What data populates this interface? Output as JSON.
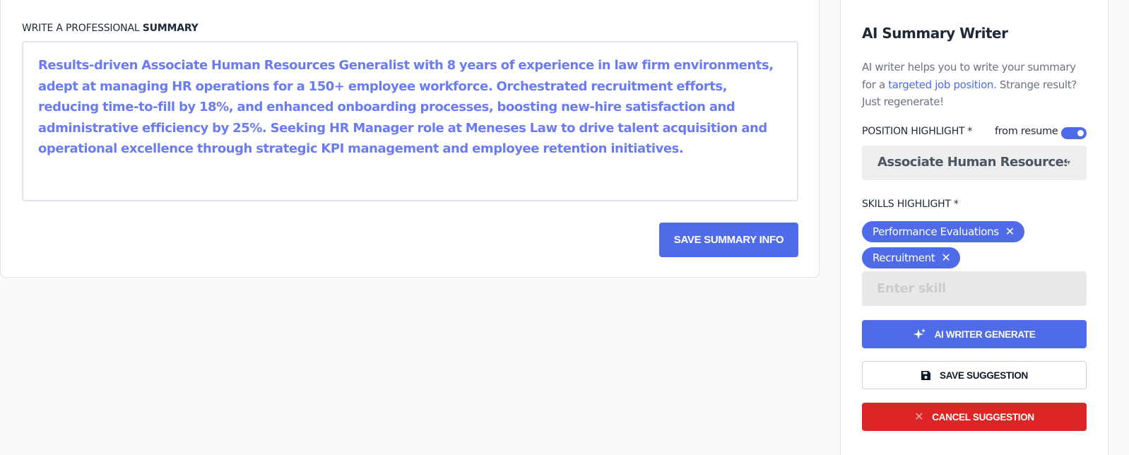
{
  "summary": {
    "heading_prefix": "WRITE A PROFESSIONAL ",
    "heading_bold": "SUMMARY",
    "text": "Results-driven Associate Human Resources Generalist with 8 years of experience in law firm environments, adept at managing HR operations for a 150+ employee workforce. Orchestrated recruitment efforts, reducing time-to-fill by 18%, and enhanced onboarding processes, boosting new-hire satisfaction and administrative efficiency by 25%. Seeking HR Manager role at Meneses Law to drive talent acquisition and operational excellence through strategic KPI management and employee retention initiatives.",
    "save_label": "SAVE SUMMARY INFO"
  },
  "ai_panel": {
    "title": "AI Summary Writer",
    "description_start": "AI writer helps you to write your summary for a ",
    "description_link": "targeted job position",
    "description_end": ". Strange result? Just regenerate!",
    "position_label": "POSITION HIGHLIGHT",
    "required_mark": "*",
    "toggle_label": "from resume",
    "toggle_on": true,
    "position_value": "Associate Human Resources Generalist",
    "skills_label": "SKILLS HIGHLIGHT",
    "skills": [
      "Performance Evaluations",
      "Recruitment"
    ],
    "skill_input_placeholder": "Enter skill",
    "generate_label": "AI WRITER GENERATE",
    "save_suggestion_label": "SAVE SUGGESTION",
    "cancel_suggestion_label": "CANCEL SUGGESTION"
  },
  "icons": {
    "generate": "sparkles-icon",
    "save": "floppy-disk-icon",
    "cancel": "close-icon",
    "chip_remove": "close-icon",
    "dropdown": "chevron-down-icon"
  },
  "colors": {
    "primary": "#4f6be8",
    "danger": "#dc2626",
    "summary_text": "#6b7cf0"
  }
}
